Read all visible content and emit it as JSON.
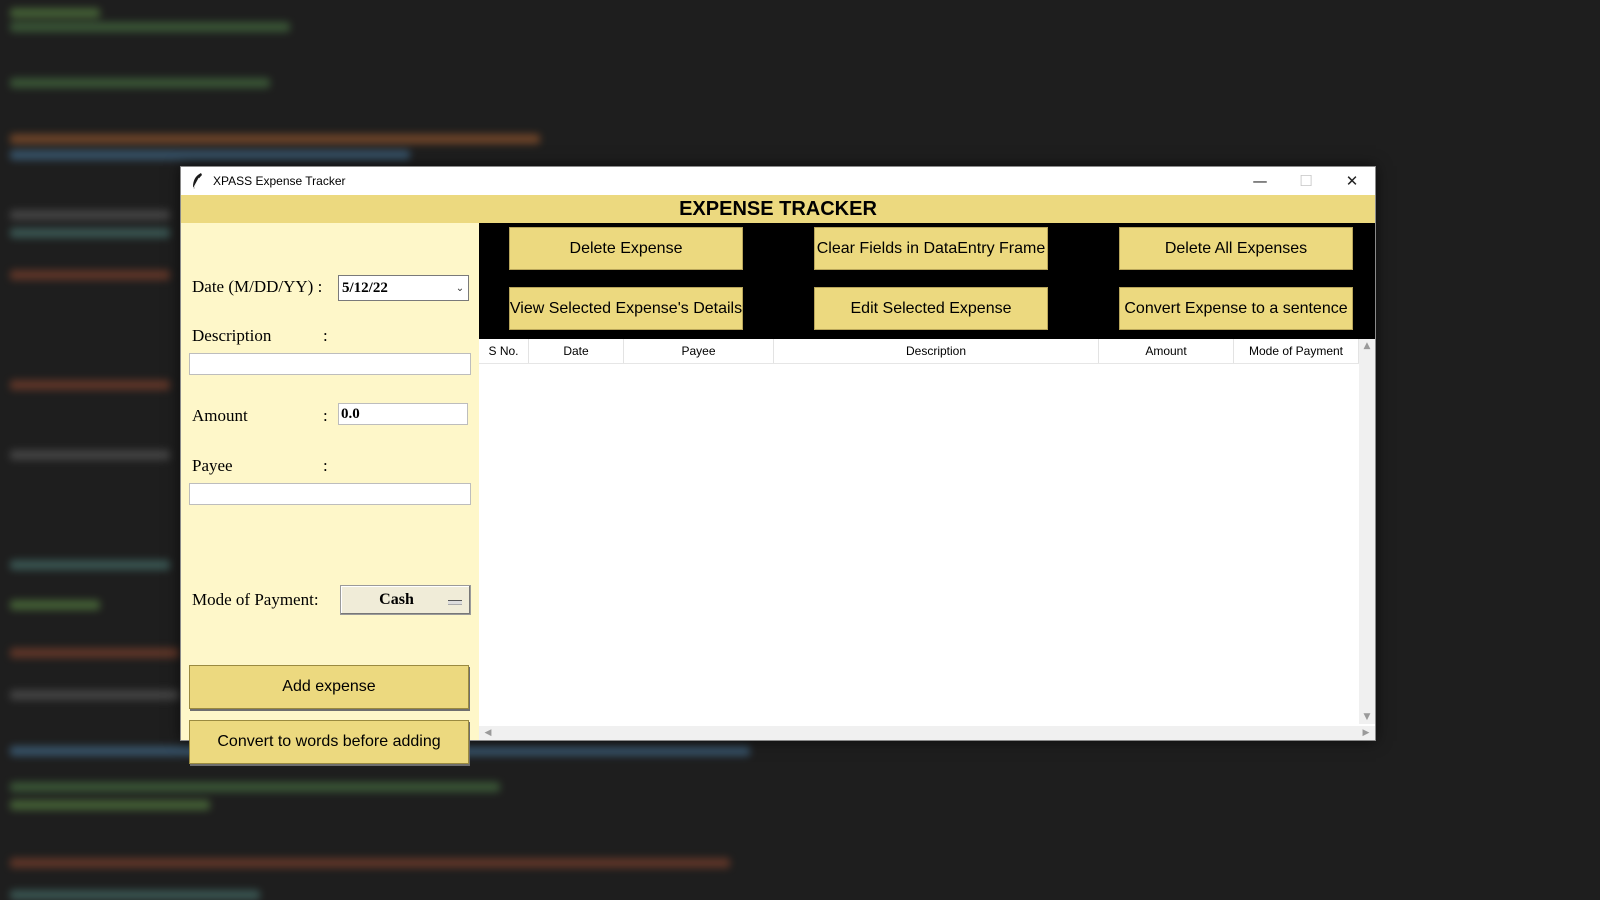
{
  "window": {
    "title": "XPASS Expense Tracker",
    "controls": {
      "minimize": "—",
      "maximize": "☐",
      "close": "✕"
    }
  },
  "header": {
    "title": "EXPENSE TRACKER"
  },
  "form": {
    "date_label": "Date (M/DD/YY) :",
    "date_value": "5/12/22",
    "description_label": "Description",
    "description_colon": ":",
    "description_value": "",
    "amount_label": "Amount",
    "amount_colon": ":",
    "amount_value": "0.0",
    "payee_label": "Payee",
    "payee_colon": ":",
    "payee_value": "",
    "mode_label": "Mode of Payment:",
    "mode_value": "Cash",
    "add_button": "Add expense",
    "convert_button": "Convert to words before adding"
  },
  "actions": {
    "delete_expense": "Delete Expense",
    "clear_fields": "Clear Fields in DataEntry Frame",
    "delete_all": "Delete All Expenses",
    "view_details": "View Selected Expense's Details",
    "edit_expense": "Edit Selected Expense",
    "convert_sentence": "Convert Expense to a sentence"
  },
  "table": {
    "columns": [
      "S No.",
      "Date",
      "Payee",
      "Description",
      "Amount",
      "Mode of Payment"
    ],
    "rows": []
  },
  "colors": {
    "accent": "#ecd97f",
    "panel": "#fef7c9",
    "button_area": "#000000"
  }
}
